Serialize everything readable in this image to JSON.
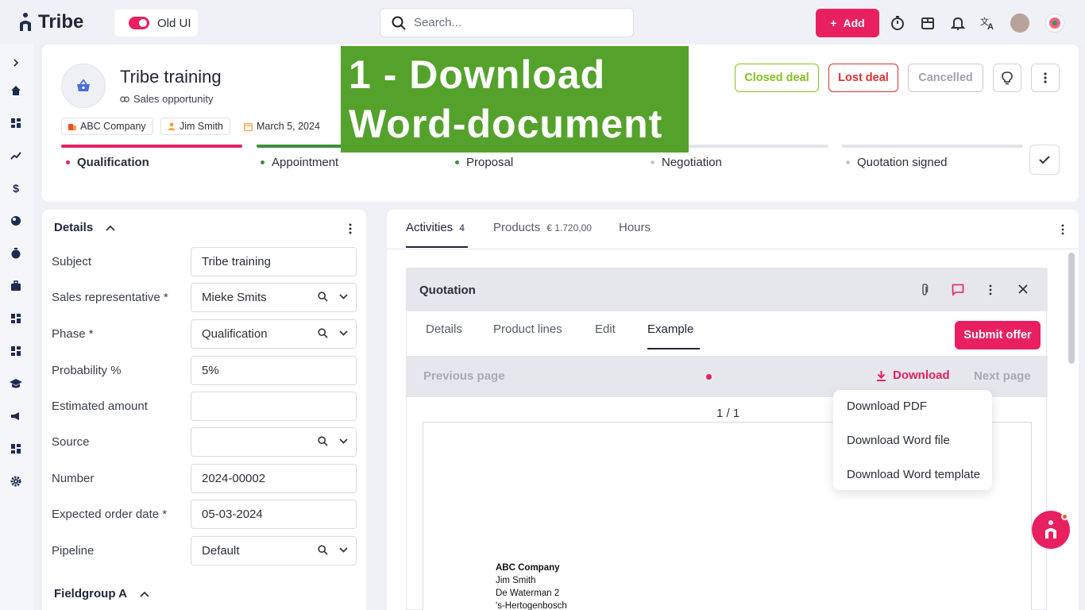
{
  "topbar": {
    "logo": "Tribe",
    "old_ui_label": "Old UI",
    "search_placeholder": "Search...",
    "add_label": "Add"
  },
  "colors": {
    "accent": "#e8205f",
    "success": "#84c225",
    "overlay": "#54a22b"
  },
  "deal": {
    "title": "Tribe training",
    "subtitle": "Sales opportunity",
    "chips": {
      "company": "ABC Company",
      "contact": "Jim Smith",
      "date": "March 5, 2024"
    },
    "buttons": {
      "closed": "Closed deal",
      "lost": "Lost deal",
      "cancelled": "Cancelled"
    },
    "stages": [
      "Qualification",
      "Appointment",
      "Proposal",
      "Negotiation",
      "Quotation signed"
    ]
  },
  "overlay_text": "1 - Download Word-document",
  "details": {
    "title": "Details",
    "fields": [
      {
        "label": "Subject",
        "value": "Tribe training"
      },
      {
        "label": "Sales representative *",
        "value": "Mieke Smits"
      },
      {
        "label": "Phase *",
        "value": "Qualification"
      },
      {
        "label": "Probability %",
        "value": "5%"
      },
      {
        "label": "Estimated amount",
        "value": ""
      },
      {
        "label": "Source",
        "value": ""
      },
      {
        "label": "Number",
        "value": "2024-00002"
      },
      {
        "label": "Expected order date *",
        "value": "05-03-2024"
      },
      {
        "label": "Pipeline",
        "value": "Default"
      }
    ],
    "fieldgroup": "Fieldgroup A"
  },
  "activities": {
    "tabs": {
      "activities": "Activities",
      "activities_count": "4",
      "products": "Products",
      "products_amount": "€ 1.720,00",
      "hours": "Hours"
    },
    "quotation": {
      "title": "Quotation",
      "tabs": [
        "Details",
        "Product lines",
        "Edit",
        "Example"
      ],
      "submit": "Submit offer",
      "prev": "Previous page",
      "download": "Download",
      "next": "Next page",
      "page": "1 / 1",
      "address": [
        "ABC Company",
        "Jim Smith",
        "De Waterman 2",
        "'s-Hertogenbosch"
      ]
    },
    "download_menu": [
      "Download PDF",
      "Download Word file",
      "Download Word template"
    ]
  }
}
